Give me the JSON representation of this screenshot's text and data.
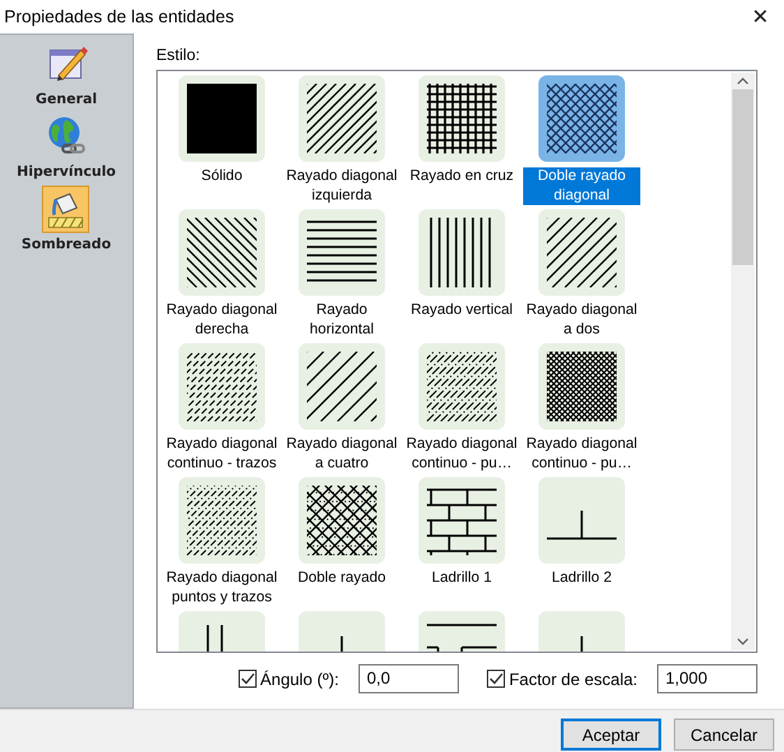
{
  "window": {
    "title": "Propiedades de las entidades",
    "close": "✕"
  },
  "sidebar": {
    "items": [
      {
        "label": "General",
        "kind": "general",
        "selected": false
      },
      {
        "label": "Hipervínculo",
        "kind": "link",
        "selected": false
      },
      {
        "label": "Sombreado",
        "kind": "fill",
        "selected": true
      }
    ]
  },
  "style_label": "Estilo:",
  "patterns": [
    {
      "kind": "solid",
      "label": "Sólido",
      "selected": false
    },
    {
      "kind": "diag_left",
      "label": "Rayado diagonal izquierda",
      "selected": false
    },
    {
      "kind": "cross",
      "label": "Rayado en cruz",
      "selected": false
    },
    {
      "kind": "diag_cross",
      "label": "Doble rayado diagonal",
      "selected": true
    },
    {
      "kind": "diag_right",
      "label": "Rayado diagonal derecha",
      "selected": false
    },
    {
      "kind": "horizontal",
      "label": "Rayado horizontal",
      "selected": false
    },
    {
      "kind": "vertical",
      "label": "Rayado vertical",
      "selected": false
    },
    {
      "kind": "diag_two",
      "label": "Rayado diagonal a dos",
      "selected": false
    },
    {
      "kind": "diag_dashed",
      "label": "Rayado diagonal continuo - trazos",
      "selected": false
    },
    {
      "kind": "diag_four",
      "label": "Rayado diagonal a cuatro",
      "selected": false
    },
    {
      "kind": "diag_dotted",
      "label": "Rayado diagonal continuo - pu…",
      "selected": false
    },
    {
      "kind": "diag_dense",
      "label": "Rayado diagonal continuo - pu…",
      "selected": false
    },
    {
      "kind": "diag_dashdot",
      "label": "Rayado diagonal puntos y trazos",
      "selected": false
    },
    {
      "kind": "double_cross",
      "label": "Doble rayado",
      "selected": false
    },
    {
      "kind": "brick1",
      "label": "Ladrillo 1",
      "selected": false
    },
    {
      "kind": "brick2",
      "label": "Ladrillo 2",
      "selected": false
    },
    {
      "kind": "double_line",
      "selected": false
    },
    {
      "kind": "short_line",
      "selected": false
    },
    {
      "kind": "stack",
      "selected": false
    },
    {
      "kind": "short_line",
      "selected": false
    }
  ],
  "angle": {
    "label": "Ángulo (º):",
    "checked": true,
    "value": "0,0"
  },
  "scale": {
    "label": "Factor de escala:",
    "checked": true,
    "value": "1,000"
  },
  "buttons": [
    {
      "label": "Aceptar",
      "default": true
    },
    {
      "label": "Cancelar",
      "default": false
    }
  ]
}
